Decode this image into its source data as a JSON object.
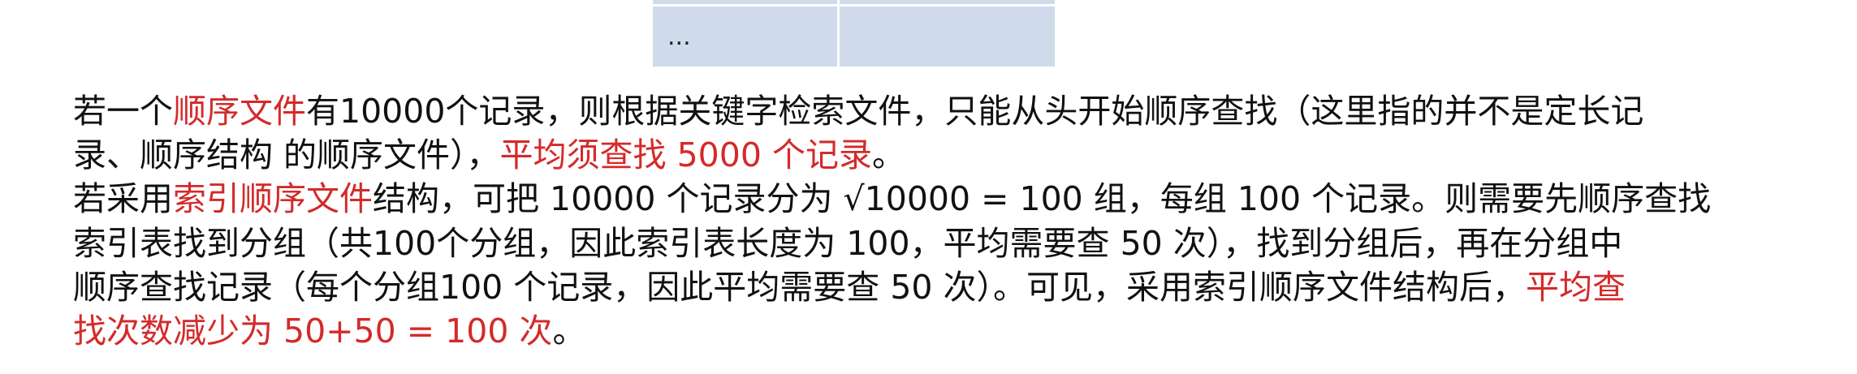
{
  "table_fragment": {
    "cell_text": "..."
  },
  "paragraphs": [
    {
      "lines": [
        [
          {
            "text": "若一个",
            "color": "dark"
          },
          {
            "text": "顺序文件",
            "color": "red"
          },
          {
            "text": "有10000个记录，则根据关键字检索文件，只能从头开始顺序查找（这里指的并不是定长记",
            "color": "dark"
          }
        ],
        [
          {
            "text": "录、顺序结构 的顺序文件），",
            "color": "dark"
          },
          {
            "text": "平均须查找 5000 个记录",
            "color": "red"
          },
          {
            "text": "。",
            "color": "dark"
          }
        ]
      ]
    },
    {
      "lines": [
        [
          {
            "text": "若采用",
            "color": "dark"
          },
          {
            "text": "索引顺序文件",
            "color": "red"
          },
          {
            "text": "结构，可把 10000 个记录分为 √10000 = 100  组，每组 100 个记录。则需要先顺序查找",
            "color": "dark"
          }
        ],
        [
          {
            "text": "索引表找到分组（共100个分组，因此索引表长度为 100，平均需要查 50 次），找到分组后，再在分组中",
            "color": "dark"
          }
        ],
        [
          {
            "text": "顺序查找记录（每个分组100 个记录，因此平均需要查 50 次）。可见，采用索引顺序文件结构后，",
            "color": "dark"
          },
          {
            "text": "平均查",
            "color": "red"
          }
        ],
        [
          {
            "text": "找次数减少为 50+50 = 100 次",
            "color": "red"
          },
          {
            "text": "。",
            "color": "dark"
          }
        ]
      ]
    }
  ],
  "colors": {
    "text": "#111111",
    "highlight": "#d42a2a",
    "table_fill": "#cfdbeb"
  }
}
